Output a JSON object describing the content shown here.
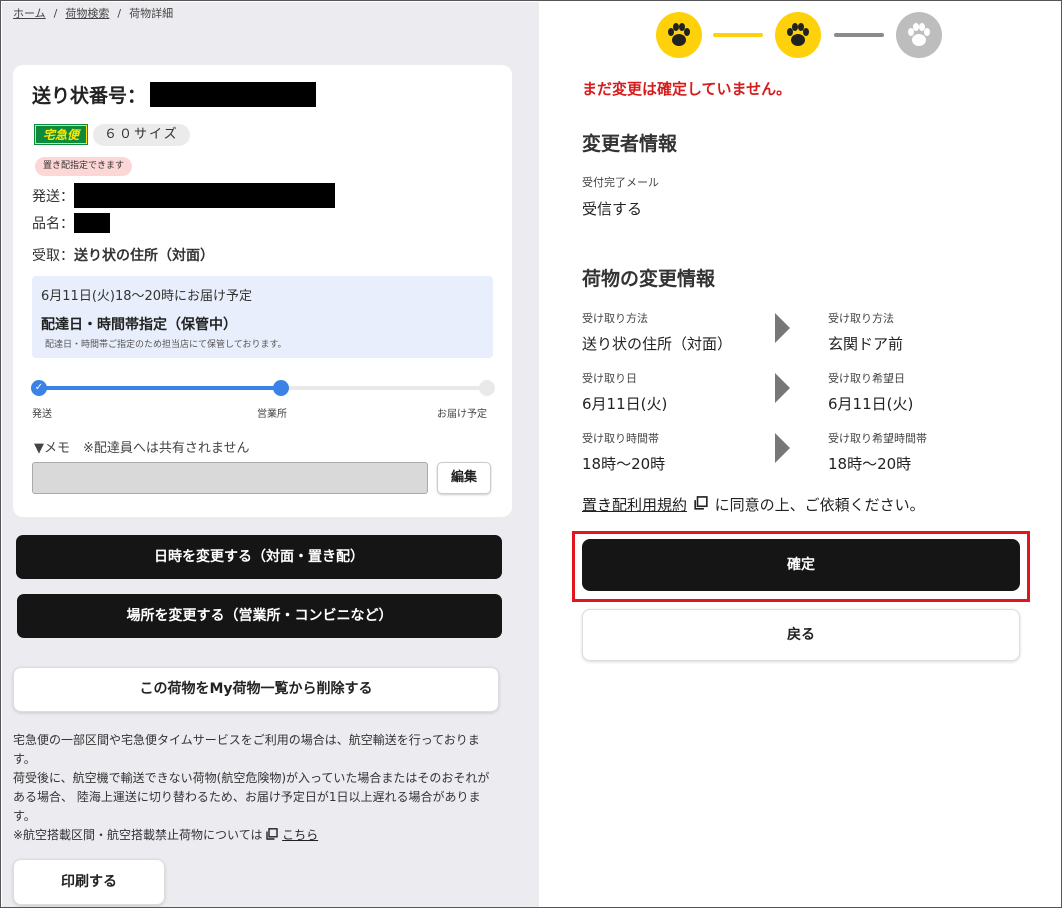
{
  "breadcrumb": {
    "home": "ホーム",
    "search": "荷物検索",
    "detail": "荷物詳細",
    "sep": "/"
  },
  "package": {
    "tracking_label": "送り状番号：",
    "service": "宅急便",
    "size": "６０サイズ",
    "okihai_badge": "置き配指定できます",
    "sender_label": "発送：",
    "item_label": "品名：",
    "receive_label": "受取：",
    "receive_value": "送り状の住所（対面）",
    "delivery_date": "6月11日(火)18～20時にお届け予定",
    "delivery_status": "配達日・時間帯指定（保管中）",
    "delivery_note": "配達日・時間帯ご指定のため担当店にて保管しております。",
    "progress": {
      "labels": [
        "発送",
        "営業所",
        "お届け予定"
      ],
      "current_fraction": 0.54
    },
    "memo_label": "▼メモ　※配達員へは共有されません",
    "memo_value": "",
    "edit_button": "編集"
  },
  "actions": {
    "change_datetime": "日時を変更する（対面・置き配）",
    "change_place": "場所を変更する（営業所・コンビニなど）",
    "delete": "この荷物をMy荷物一覧から削除する",
    "print": "印刷する"
  },
  "notice": {
    "p1": "宅急便の一部区間や宅急便タイムサービスをご利用の場合は、航空輸送を行っております。",
    "p2": "荷受後に、航空機で輸送できない荷物(航空危険物)が入っていた場合またはそのおそれがある場合、 陸海上運送に切り替わるため、お届け予定日が1日以上遅れる場合があります。",
    "p3_prefix": "※航空搭載区間・航空搭載禁止荷物については",
    "p3_link": "こちら"
  },
  "confirm": {
    "steps": {
      "total": 3,
      "completed": 2
    },
    "colors": {
      "active": "#ffd10a",
      "inactive": "#bdbdbd",
      "warning": "#d81b1b"
    },
    "warning": "まだ変更は確定していません。",
    "changer_title": "変更者情報",
    "mail_label": "受付完了メール",
    "mail_value": "受信する",
    "change_title": "荷物の変更情報",
    "rows": [
      {
        "from_label": "受け取り方法",
        "from_value": "送り状の住所（対面）",
        "to_label": "受け取り方法",
        "to_value": "玄関ドア前"
      },
      {
        "from_label": "受け取り日",
        "from_value": "6月11日(火)",
        "to_label": "受け取り希望日",
        "to_value": "6月11日(火)"
      },
      {
        "from_label": "受け取り時間帯",
        "from_value": "18時～20時",
        "to_label": "受け取り希望時間帯",
        "to_value": "18時～20時"
      }
    ],
    "terms_link": "置き配利用規約",
    "terms_suffix": "に同意の上、ご依頼ください。",
    "confirm_button": "確定",
    "back_button": "戻る"
  }
}
